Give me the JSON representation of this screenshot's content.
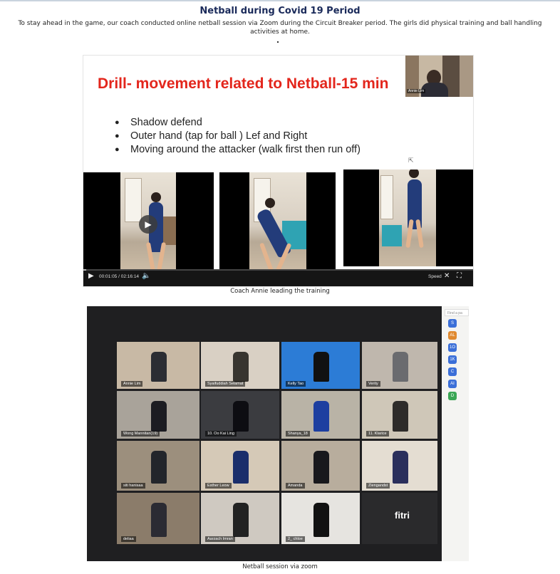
{
  "header": {
    "title": "Netball during Covid 19 Period",
    "intro": "To stay ahead in the game, our coach conducted online netball session via Zoom during the Circuit Breaker period. The girls did physical training and ball handling activities at home."
  },
  "slide": {
    "title": "Drill- movement related to Netball-15 min",
    "bullets": [
      "Shadow defend",
      "Outer hand (tap for ball ) Lef and Right",
      "Moving around the attacker (walk first then run off)"
    ],
    "presenter_label": "Annie Lim",
    "accent_color": "#e3261c"
  },
  "video_player": {
    "current_time": "00:01:05",
    "duration": "02:16:14",
    "time_separator": "/",
    "speed_label": "Speed",
    "progress_fraction": 0.008,
    "icons": [
      "play-icon",
      "volume-icon",
      "fullscreen-exit-icon",
      "fullscreen-icon"
    ]
  },
  "caption_1": "Coach Annie leading the training",
  "zoom": {
    "search_placeholder": "Find a pa",
    "participants": [
      "Annie Lim",
      "Syaifuddiah Selamat",
      "Kelly Tao",
      "Verity",
      "Wong Mannitan(19)",
      "10. Oo Kai Ling",
      "Shanya_18",
      "11. Klarice",
      "siti hanisaa",
      "Esther Leow",
      "Amanda",
      "Ziengandst",
      "deliaa",
      "Aarzach Imran",
      "2_ chloe",
      "fitri"
    ],
    "side_avatars": [
      {
        "label": "S",
        "color": "#3b6fd8"
      },
      {
        "label": "AL",
        "color": "#e0892f"
      },
      {
        "label": "1O",
        "color": "#3b6fd8"
      },
      {
        "label": "1K",
        "color": "#3b6fd8"
      },
      {
        "label": "C",
        "color": "#3b6fd8"
      },
      {
        "label": "AI",
        "color": "#3b6fd8"
      },
      {
        "label": "D",
        "color": "#3aa654"
      }
    ],
    "active_speaker_color": "#c7e03a"
  },
  "caption_2": "Netball session via zoom"
}
